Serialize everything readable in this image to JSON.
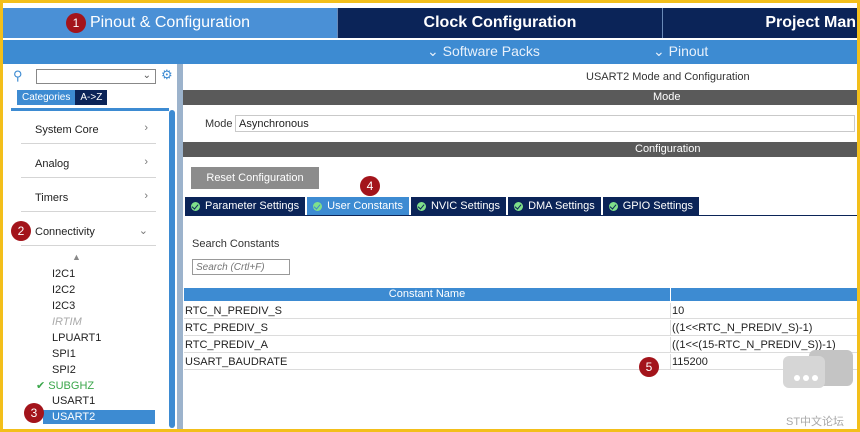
{
  "top_tabs": [
    {
      "label": "Pinout & Configuration"
    },
    {
      "label": "Clock Configuration"
    },
    {
      "label": "Project Man"
    }
  ],
  "subbar": {
    "software_packs": "Software Packs",
    "pinout": "Pinout"
  },
  "sidebar": {
    "tab_categories": "Categories",
    "tab_az": "A->Z",
    "categories": [
      {
        "label": "System Core"
      },
      {
        "label": "Analog"
      },
      {
        "label": "Timers"
      },
      {
        "label": "Connectivity"
      }
    ],
    "connectivity_items": [
      {
        "label": "I2C1"
      },
      {
        "label": "I2C2"
      },
      {
        "label": "I2C3"
      },
      {
        "label": "IRTIM"
      },
      {
        "label": "LPUART1"
      },
      {
        "label": "SPI1"
      },
      {
        "label": "SPI2"
      },
      {
        "label": "SUBGHZ"
      },
      {
        "label": "USART1"
      },
      {
        "label": "USART2"
      }
    ]
  },
  "main": {
    "title": "USART2 Mode and Configuration",
    "mode_header": "Mode",
    "mode_label": "Mode",
    "mode_value": "Asynchronous",
    "config_header": "Configuration",
    "reset_button": "Reset Configuration",
    "config_tabs": [
      {
        "label": "Parameter Settings"
      },
      {
        "label": "User Constants"
      },
      {
        "label": "NVIC Settings"
      },
      {
        "label": "DMA Settings"
      },
      {
        "label": "GPIO Settings"
      }
    ],
    "search_label": "Search Constants",
    "search_placeholder": "Search (Crtl+F)",
    "table_header": "Constant Name",
    "rows": [
      {
        "name": "RTC_N_PREDIV_S",
        "value": "10"
      },
      {
        "name": "RTC_PREDIV_S",
        "value": "((1<<RTC_N_PREDIV_S)-1)"
      },
      {
        "name": "RTC_PREDIV_A",
        "value": "((1<<(15-RTC_N_PREDIV_S))-1)"
      },
      {
        "name": "USART_BAUDRATE",
        "value": "115200"
      }
    ]
  },
  "markers": [
    "1",
    "2",
    "3",
    "4",
    "5"
  ],
  "watermark": "ST中文论坛",
  "colors": {
    "accent": "#3d8bd2",
    "navy": "#0b2458",
    "marker": "#a3141b",
    "ok": "#3aa64a",
    "frame": "#f3bf1a"
  }
}
